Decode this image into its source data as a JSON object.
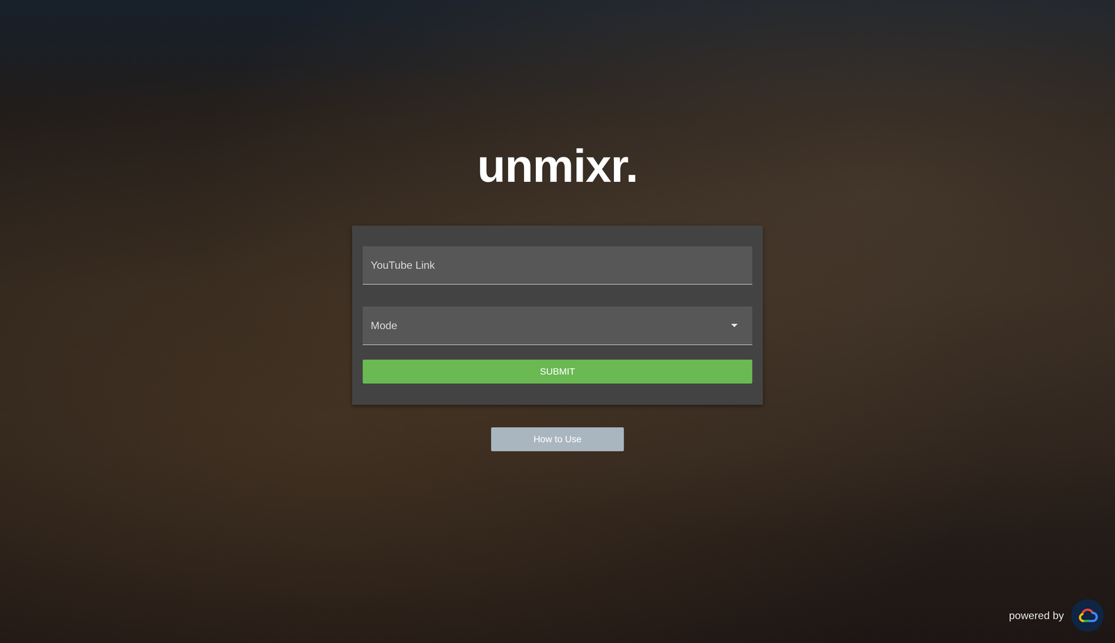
{
  "app": {
    "title": "unmixr."
  },
  "form": {
    "fields": [
      {
        "kind": "text",
        "label": "YouTube Link"
      },
      {
        "kind": "select",
        "label": "Mode"
      }
    ],
    "submit": "SUBMIT"
  },
  "help_button": "How to Use",
  "footer": {
    "text": "powered by"
  }
}
